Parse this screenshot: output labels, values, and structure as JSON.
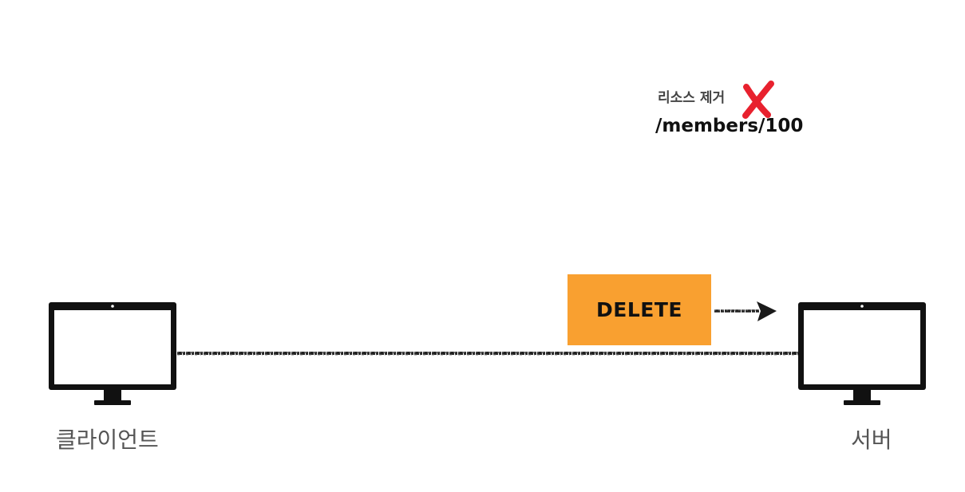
{
  "client": {
    "label": "클라이언트"
  },
  "server": {
    "label": "서버"
  },
  "request": {
    "method": "DELETE"
  },
  "resource": {
    "note": "리소스 제거",
    "path": "/members/100"
  },
  "colors": {
    "request_box": "#f9a030",
    "delete_mark": "#e8212e",
    "line": "#111111"
  },
  "icons": {
    "client": "monitor-icon",
    "server": "monitor-icon",
    "delete": "x-mark-icon",
    "arrow": "arrow-right-icon"
  }
}
